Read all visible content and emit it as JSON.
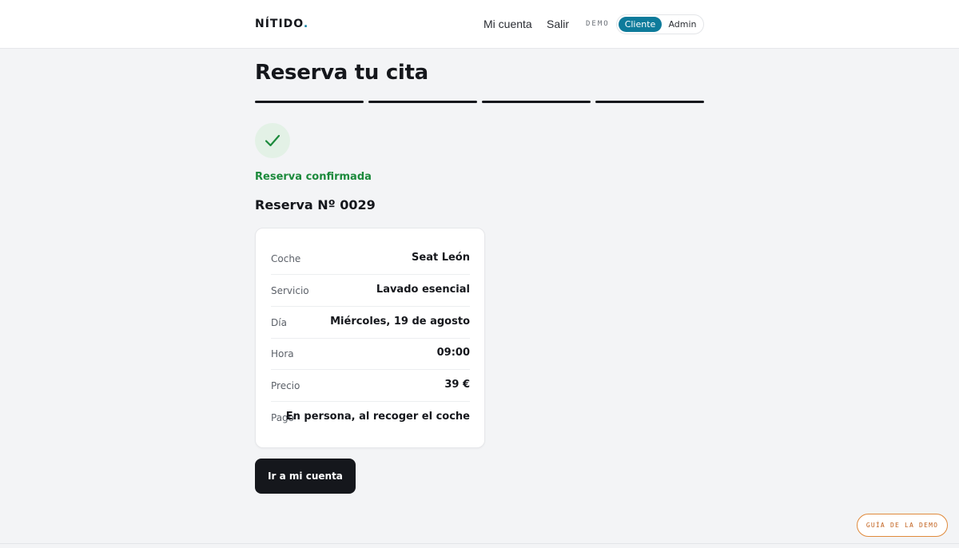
{
  "header": {
    "brand": "NÍTIDO",
    "brand_dot": ".",
    "nav": {
      "account": "Mi cuenta",
      "logout": "Salir"
    },
    "demo_label": "DEMO",
    "mode_toggle": {
      "options": [
        "Cliente",
        "Admin"
      ],
      "selected": "Cliente"
    }
  },
  "main": {
    "title": "Reserva tu cita",
    "steps_total": 4,
    "steps_completed": 4,
    "status": "Reserva confirmada",
    "booking_number": "Reserva Nº 0029",
    "details": [
      {
        "label": "Coche",
        "value": "Seat León"
      },
      {
        "label": "Servicio",
        "value": "Lavado esencial"
      },
      {
        "label": "Día",
        "value": "Miércoles, 19 de agosto"
      },
      {
        "label": "Hora",
        "value": "09:00"
      },
      {
        "label": "Precio",
        "value": "39 €"
      },
      {
        "label": "Pago",
        "value": "En persona, al recoger el coche"
      }
    ],
    "cta": "Ir a mi cuenta"
  },
  "guide_button": "GUÍA DE LA DEMO",
  "colors": {
    "accent": "#0e7b9b",
    "success": "#1c8a3c",
    "success_bg": "#e3f1e6",
    "dark": "#15171c",
    "guide_orange": "#c2611d"
  }
}
